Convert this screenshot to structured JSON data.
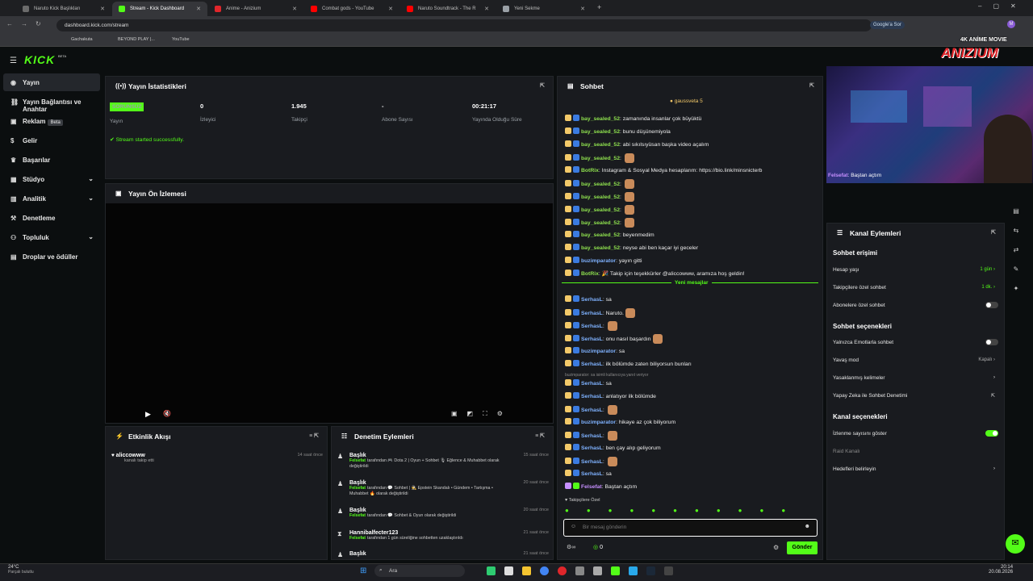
{
  "browser": {
    "tabs": [
      {
        "label": "Naruto Kick Başlıkları",
        "color": "#6b6b6b"
      },
      {
        "label": "Stream - Kick Dashboard",
        "color": "#53fc18"
      },
      {
        "label": "Anime - Anizium",
        "color": "#e0262b"
      },
      {
        "label": "Combat gods - YouTube",
        "color": "#ff0000"
      },
      {
        "label": "Naruto Soundtrack - The R",
        "color": "#ff0000"
      },
      {
        "label": "Yeni Sekme",
        "color": "#9aa0a6"
      }
    ],
    "url": "dashboard.kick.com/stream",
    "google_btn": "Google'a Sor",
    "bookmarks": [
      "Gachakuta",
      "BEYOND PLAY |...",
      "YouTube"
    ]
  },
  "kick": {
    "logo": "KICK",
    "beta": "BETA"
  },
  "sidebar": [
    {
      "label": "Yayın",
      "icon": "broadcast-icon",
      "active": true
    },
    {
      "label": "Yayın Bağlantısı ve Anahtar",
      "icon": "link-icon"
    },
    {
      "label": "Reklam",
      "icon": "ad-icon",
      "badge": "Beta"
    },
    {
      "label": "Gelir",
      "icon": "dollar-icon"
    },
    {
      "label": "Başarılar",
      "icon": "trophy-icon"
    },
    {
      "label": "Stüdyo",
      "icon": "studio-icon",
      "chevron": true
    },
    {
      "label": "Analitik",
      "icon": "chart-icon",
      "chevron": true
    },
    {
      "label": "Denetleme",
      "icon": "hammer-icon"
    },
    {
      "label": "Topluluk",
      "icon": "community-icon",
      "chevron": true
    },
    {
      "label": "Droplar ve ödüller",
      "icon": "gift-icon"
    }
  ],
  "stats": {
    "title": "Yayın İstatistikleri",
    "status_badge": "SORUNSUZ",
    "items": [
      {
        "value": "",
        "label": "Yayın"
      },
      {
        "value": "0",
        "label": "İzleyici"
      },
      {
        "value": "1.945",
        "label": "Takipçi"
      },
      {
        "value": "-",
        "label": "Abone Sayısı"
      },
      {
        "value": "00:21:17",
        "label": "Yayında Olduğu Süre"
      }
    ],
    "success": "Stream started successfully."
  },
  "preview": {
    "title": "Yayın Ön İzlemesi"
  },
  "activity": {
    "title": "Etkinlik Akışı",
    "items": [
      {
        "user": "aliccowww",
        "text": "kanalı takip etti",
        "time": "14 saat önce"
      }
    ]
  },
  "moderation": {
    "title": "Denetim Eylemleri",
    "items": [
      {
        "title": "Başlık",
        "actor": "Felsefat",
        "text": "tarafından 🎮 Dota 2 | Oyun + Sohbet 🎙 Eğlence & Muhabbet olarak değiştirildi",
        "time": "15 saat önce"
      },
      {
        "title": "Başlık",
        "actor": "Felsefat",
        "text": "tarafından 💬 Sohbet | 🕵 Epstein Skandalı • Gündem • Tartışma • Muhabbet 🔥 olarak değiştirildi",
        "time": "20 saat önce"
      },
      {
        "title": "Başlık",
        "actor": "Felsefat",
        "text": "tarafından 💬 Sohbet & Oyun olarak değiştirildi",
        "time": "20 saat önce"
      },
      {
        "title": "Hannibalfecter123",
        "actor": "Felsefat",
        "text": "tarafından 1 gün süreliğine sohbetten uzaklaştırıldı",
        "time": "21 saat önce"
      },
      {
        "title": "Başlık",
        "actor": "",
        "text": "",
        "time": "21 saat önce"
      }
    ]
  },
  "chat": {
    "title": "Sohbet",
    "pinned": "gaussveta 5",
    "new_messages": "Yeni mesajlar",
    "reply_hint": "buzimparator: sa isimli kullanıcıya yanıt veriyor",
    "followers_only": "Takipçilere Özel",
    "input_placeholder": "Bir mesaj gönderin",
    "count": "0",
    "send": "Gönder",
    "messages": [
      {
        "user": "bay_sealed_52",
        "text": "zamanında insanlar çok büyüktü",
        "cls": "u"
      },
      {
        "user": "bay_sealed_52",
        "text": "bunu düşünemiyola",
        "cls": "u"
      },
      {
        "user": "bay_sealed_52",
        "text": "abi sıkılsıyüsan başka video açalım",
        "cls": "u"
      },
      {
        "user": "bay_sealed_52",
        "text": "",
        "cls": "u",
        "emote": true
      },
      {
        "user": "BotRix",
        "text": "Instagram & Sosyal Medya hesaplarım: https://bio.link/minsnicterb",
        "cls": "u"
      },
      {
        "user": "bay_sealed_52",
        "text": "",
        "cls": "u",
        "emote": true
      },
      {
        "user": "bay_sealed_52",
        "text": "",
        "cls": "u",
        "emote": true
      },
      {
        "user": "bay_sealed_52",
        "text": "",
        "cls": "u",
        "emote": true
      },
      {
        "user": "bay_sealed_52",
        "text": "",
        "cls": "u",
        "emote": true
      },
      {
        "user": "bay_sealed_52",
        "text": "beyenmedim",
        "cls": "u"
      },
      {
        "user": "bay_sealed_52",
        "text": "neyse abi ben kaçar iyi geceler",
        "cls": "u"
      },
      {
        "user": "buzimparator",
        "text": "yayın gitti",
        "cls": "u2"
      },
      {
        "user": "BotRix",
        "text": "🎉 Takip için teşekkürler @aliccowww, aramıza hoş geldin!",
        "cls": "u"
      },
      {
        "user": "SerhasL",
        "text": "sa",
        "cls": "u2"
      },
      {
        "user": "SerhasL",
        "text": "Naruto.",
        "cls": "u2",
        "emote": true
      },
      {
        "user": "SerhasL",
        "text": "",
        "cls": "u2",
        "emote": true
      },
      {
        "user": "SerhasL",
        "text": "onu nasıl başardın",
        "cls": "u2",
        "emote": true
      },
      {
        "user": "buzimparator",
        "text": "sa",
        "cls": "u2"
      },
      {
        "user": "SerhasL",
        "text": "ilk bölümde zaten biliyorsun bunları",
        "cls": "u2"
      },
      {
        "user": "SerhasL",
        "text": "sa",
        "cls": "u2"
      },
      {
        "user": "SerhasL",
        "text": "anlatıyor ilk bölümde",
        "cls": "u2"
      },
      {
        "user": "SerhasL",
        "text": "",
        "cls": "u2",
        "emote": true
      },
      {
        "user": "buzimparator",
        "text": "hikaye az çok biliyorum",
        "cls": "u2"
      },
      {
        "user": "SerhasL",
        "text": "",
        "cls": "u2",
        "emote": true
      },
      {
        "user": "SerhasL",
        "text": "ben çay alıp geliyorum",
        "cls": "u2"
      },
      {
        "user": "SerhasL",
        "text": "",
        "cls": "u2",
        "emote": true
      },
      {
        "user": "SerhasL",
        "text": "sa",
        "cls": "u2"
      },
      {
        "user": "Felsefat",
        "text": "Baştan açtım",
        "cls": "u3"
      }
    ]
  },
  "webcam": {
    "user": "Felsefat",
    "text": "Baştan açtım",
    "brand": "4K ANİME MOVIE",
    "brand2": "ANIZIUM"
  },
  "channel_actions": {
    "title": "Kanal Eylemleri",
    "sec1": "Sohbet erişimi",
    "hesap": {
      "label": "Hesap yaşı",
      "value": "1 gün"
    },
    "takipci": {
      "label": "Takipçilere özel sohbet",
      "value": "1 dk."
    },
    "abone": {
      "label": "Abonelere özel sohbet"
    },
    "sec2": "Sohbet seçenekleri",
    "emote": {
      "label": "Yalnızca Emotlarla sohbet"
    },
    "yavas": {
      "label": "Yavaş mod",
      "value": "Kapalı"
    },
    "yasak": {
      "label": "Yasaklanmış kelimeler"
    },
    "ai": {
      "label": "Yapay Zeka ile Sohbet Denetimi"
    },
    "sec3": "Kanal seçenekleri",
    "izlenme": {
      "label": "İzlenme sayısını göster"
    },
    "raid": {
      "label": "Raid Kanalı"
    },
    "hedef": {
      "label": "Hedefleri belirleyin"
    }
  },
  "taskbar": {
    "weather": "24°C",
    "weather2": "Parçalı bulutlu",
    "search": "Ara",
    "time": "20:14",
    "date": "20.08.2026"
  }
}
